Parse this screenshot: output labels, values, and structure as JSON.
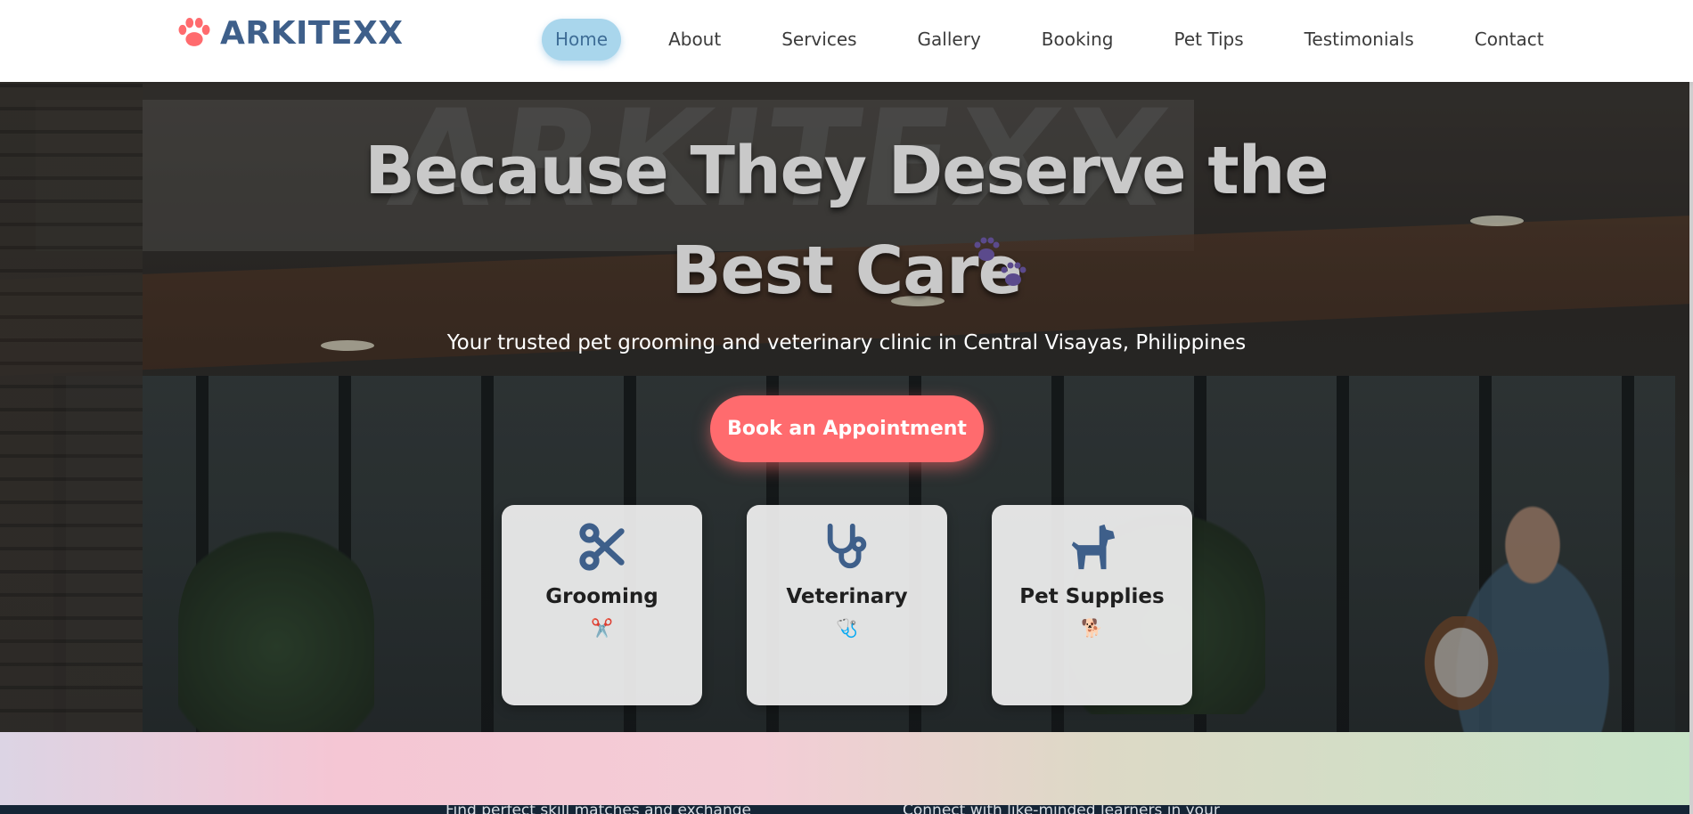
{
  "brand": {
    "name": "ARKITEXX",
    "color": "#3e5f8a",
    "accent": "#ff6b6e"
  },
  "nav": {
    "items": [
      {
        "label": "Home",
        "active": true
      },
      {
        "label": "About"
      },
      {
        "label": "Services"
      },
      {
        "label": "Gallery"
      },
      {
        "label": "Booking"
      },
      {
        "label": "Pet Tips"
      },
      {
        "label": "Testimonials"
      },
      {
        "label": "Contact"
      }
    ]
  },
  "hero": {
    "background_sign": "ARKITEXX",
    "title_line1": "Because They Deserve the",
    "title_line2": "Best Care",
    "title_icon": "paw-prints-icon",
    "subtitle": "Your trusted pet grooming and veterinary clinic in Central Visayas, Philippines",
    "cta_label": "Book an Appointment"
  },
  "cards": [
    {
      "title": "Grooming",
      "icon": "scissors-icon",
      "emoji": "✂️"
    },
    {
      "title": "Veterinary",
      "icon": "stethoscope-icon",
      "emoji": "🩺"
    },
    {
      "title": "Pet Supplies",
      "icon": "dog-icon",
      "emoji": "🐕"
    }
  ],
  "below_fold": {
    "text_left": "Find perfect skill matches and exchange",
    "text_right": "Connect with like-minded learners in your"
  }
}
